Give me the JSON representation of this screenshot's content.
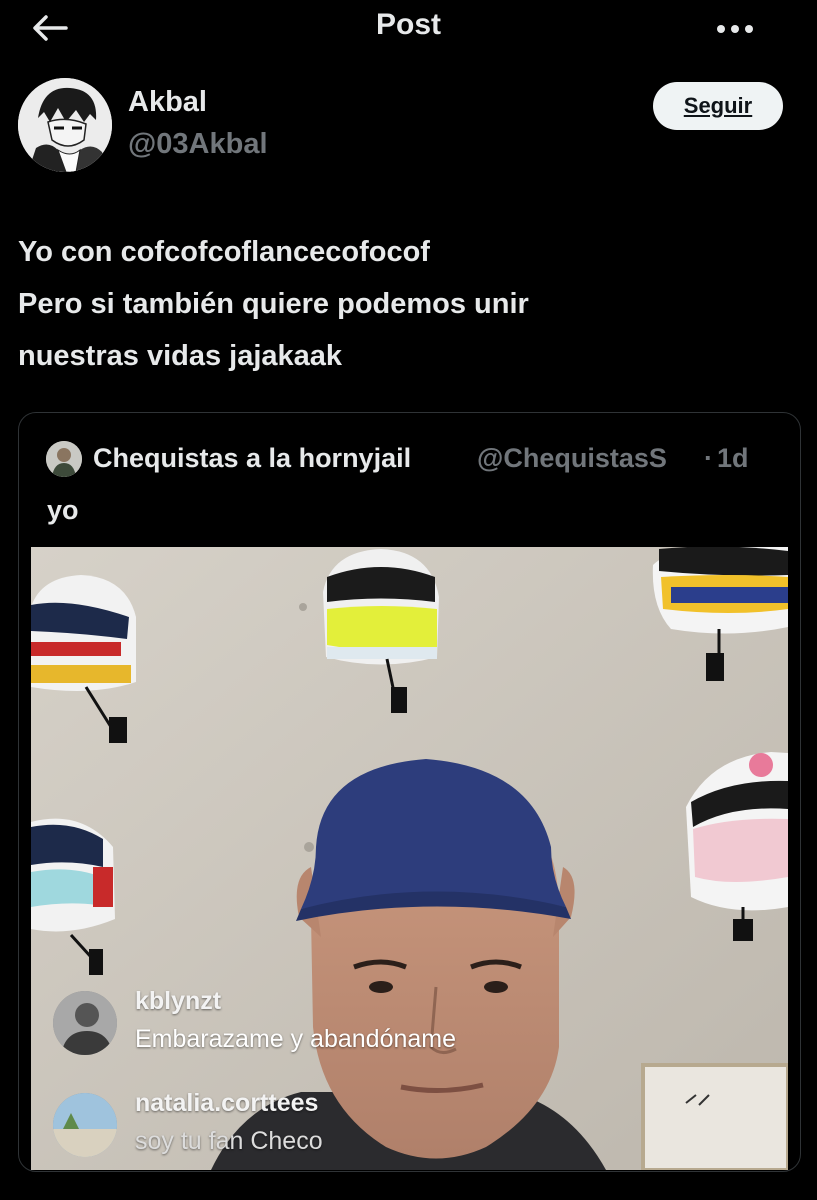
{
  "header": {
    "title": "Post",
    "back_icon": "arrow-left-icon",
    "more_icon": "more-horizontal-icon"
  },
  "author": {
    "display_name": "Akbal",
    "handle": "@03Akbal",
    "avatar_icon": "anime-avatar"
  },
  "follow_button": {
    "label": "Seguir"
  },
  "tweet": {
    "lines": [
      "Yo con cofcofcoflancecofocof",
      "Pero si también quiere podemos unir",
      "nuestras vidas jajakaak"
    ]
  },
  "quoted": {
    "display_name": "Chequistas a la hornyjail",
    "handle": "@ChequistasS",
    "separator": "·",
    "time": "1d",
    "text": "yo",
    "media": {
      "comments": [
        {
          "user": "kblynzt",
          "text": "Embarazame y abandóname"
        },
        {
          "user": "natalia.corttees",
          "text": "soy tu fan Checo"
        }
      ]
    }
  },
  "colors": {
    "background": "#000000",
    "text": "#e7e9ea",
    "muted": "#71767b",
    "border": "#2f3336",
    "follow_bg": "#eff3f4"
  }
}
